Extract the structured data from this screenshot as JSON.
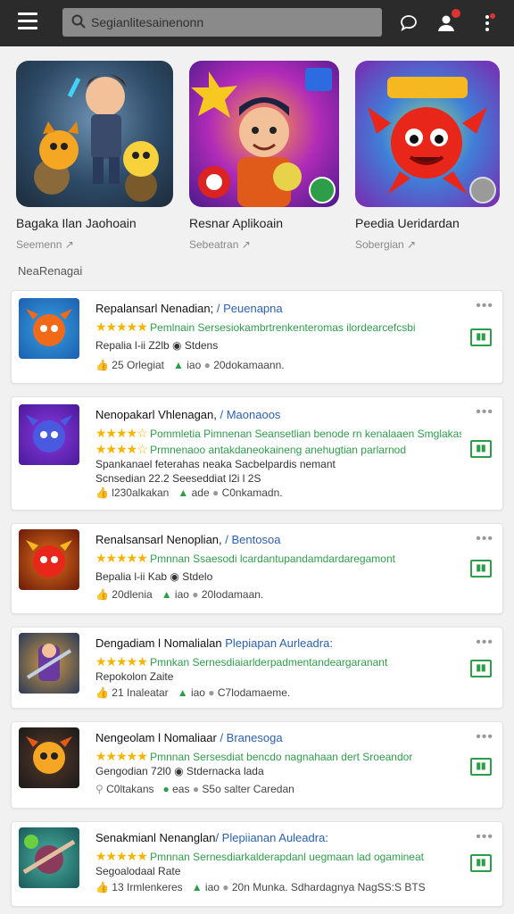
{
  "topbar": {
    "search_placeholder": "Segianlitesainenonn"
  },
  "featured": [
    {
      "title": "Bagaka Ilan Jaohoain",
      "sub": "Seemenn  ↗"
    },
    {
      "title": "Resnar Aplikoain",
      "sub": "Sebeatran  ↗"
    },
    {
      "title": "Peedia Ueridardan",
      "sub": "Sobergian  ↗"
    }
  ],
  "section_title": "NeaRenagai",
  "apps": [
    {
      "title": "Repalansarl Nenadian; ",
      "category": "/ Peuenapna",
      "stars": "★★★★★",
      "line1": "Pemlnain  Sersesiokambrtrenkenteromas ilordearcefcsbi",
      "line2": "Repalia l-ii Z2lb",
      "line2b": "Stdens",
      "meta_a": "25 Orlegiat",
      "meta_b": "iao",
      "meta_c": "20dokamaann."
    },
    {
      "title": "Nenopakarl Vhlenagan, ",
      "category": "/ Maonaoos",
      "stars": "★★★★☆",
      "line1": "Pommletia  Pimnenan Seansetlian benode rn  kenalaaen Smglakaspa.",
      "line1b_stars": "★★★★☆",
      "line1b": "Prmnenaoo  antakdaneokaineng anehugtian parlarnod",
      "line2": "Spankanael feterahas neaka Sacbelpardis nemant",
      "line2b": "Scnsedian 22.2  Seeseddiat l2i l 2S",
      "meta_a": "l230alkakan",
      "meta_b": "ade",
      "meta_c": "C0nkamadn."
    },
    {
      "title": "Renalsansarl Nenoplian, ",
      "category": "/ Bentosoa",
      "stars": "★★★★★",
      "line1": "Pmnnan  Ssaesodi lcardantupandamdardaregamont",
      "line2": "Bepalia l-ii Kab",
      "line2b": "Stdelo",
      "meta_a": "20dlenia",
      "meta_b": "iao",
      "meta_c": "20lodamaan."
    },
    {
      "title": "Dengadiam l Nomalialan ",
      "category": "Plepiapan Aurleadra:",
      "stars": "★★★★★",
      "line1": "Pmnkan  Sernesdiaiarlderpadmentandeargaranant",
      "line2": "Repokolon Zaite",
      "line2b": "",
      "meta_a": "21 Inaleatar",
      "meta_b": "iao",
      "meta_c": "C7lodamaeme."
    },
    {
      "title": "Nengeolam l Nomaliaar ",
      "category": "/ Branesoga",
      "stars": "★★★★★",
      "line1": "Pmnnan  Sersesdiat bencdo nagnahaan dert Sroeandor",
      "line2": "Gengodian 72l0",
      "line2b": "Stdernacka lada",
      "meta_a": "C0ltakans",
      "meta_b": "eas",
      "meta_c": "S5o salter Caredan"
    },
    {
      "title": "Senakmianl Nenanglan",
      "category": "/ Plepiianan Auleadra:",
      "stars": "★★★★★",
      "line1": "Pmnnan  Sernesdiarkalderapdanl uegmaan lad ogamineat",
      "line2": "Segoalodaal Rate",
      "line2b": "",
      "meta_a": "13 Irmlenkeres",
      "meta_b": "iao",
      "meta_c": "20n Munka.  Sdhardagnya NagSS:S BTS"
    }
  ]
}
